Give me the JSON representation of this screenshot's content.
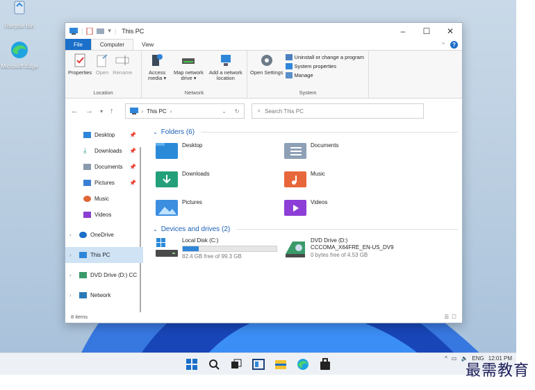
{
  "desktop": {
    "icons": [
      {
        "label": "Recycle Bin",
        "icon": "recycle-bin-icon"
      },
      {
        "label": "Microsoft Edge",
        "icon": "edge-icon"
      }
    ]
  },
  "window": {
    "title": "This PC",
    "controls": {
      "minimize": "–",
      "maximize": "☐",
      "close": "✕"
    }
  },
  "tabs": {
    "file": "File",
    "computer": "Computer",
    "view": "View"
  },
  "ribbon": {
    "location": {
      "label": "Location",
      "buttons": [
        {
          "label": "Properties",
          "icon": "properties-icon"
        },
        {
          "label": "Open",
          "icon": "open-icon"
        },
        {
          "label": "Rename",
          "icon": "rename-icon"
        }
      ]
    },
    "network": {
      "label": "Network",
      "buttons": [
        {
          "label": "Access media ▾",
          "icon": "access-media-icon"
        },
        {
          "label": "Map network drive ▾",
          "icon": "map-drive-icon"
        },
        {
          "label": "Add a network location",
          "icon": "add-network-location-icon"
        }
      ]
    },
    "system": {
      "label": "System",
      "open_settings": "Open Settings",
      "links": [
        {
          "label": "Uninstall or change a program",
          "icon": "uninstall-icon"
        },
        {
          "label": "System properties",
          "icon": "system-properties-icon"
        },
        {
          "label": "Manage",
          "icon": "manage-icon"
        }
      ]
    }
  },
  "address": {
    "path_label": "This PC",
    "search_placeholder": "Search This PC"
  },
  "navpane": {
    "quick_access": [
      {
        "label": "Desktop",
        "pinned": true
      },
      {
        "label": "Downloads",
        "pinned": true
      },
      {
        "label": "Documents",
        "pinned": true
      },
      {
        "label": "Pictures",
        "pinned": true
      },
      {
        "label": "Music",
        "pinned": false
      },
      {
        "label": "Videos",
        "pinned": false
      }
    ],
    "locations": [
      {
        "label": "OneDrive"
      },
      {
        "label": "This PC"
      },
      {
        "label": "DVD Drive (D:) CC"
      },
      {
        "label": "Network"
      }
    ]
  },
  "folders": {
    "heading": "Folders (6)",
    "items": [
      {
        "label": "Desktop"
      },
      {
        "label": "Documents"
      },
      {
        "label": "Downloads"
      },
      {
        "label": "Music"
      },
      {
        "label": "Pictures"
      },
      {
        "label": "Videos"
      }
    ]
  },
  "devices": {
    "heading": "Devices and drives (2)",
    "drives": [
      {
        "name": "Local Disk (C:)",
        "detail": "82.4 GB free of 99.3 GB",
        "used_fraction": 0.17
      },
      {
        "name": "DVD Drive (D:)",
        "volume": "CCCOMA_X64FRE_EN-US_DV9",
        "detail": "0 bytes free of 4.53 GB"
      }
    ]
  },
  "status": {
    "count": "8 items"
  },
  "taskbar": {
    "apps": [
      "start-icon",
      "search-icon",
      "task-view-icon",
      "widgets-icon",
      "file-explorer-icon",
      "edge-icon",
      "store-icon"
    ],
    "tray_lang": "ENG",
    "time": "12:01 PM"
  },
  "watermark": "最需教育",
  "colors": {
    "accent": "#1a6fc8",
    "selected": "#cfe3f5",
    "link": "#1a5fb4"
  }
}
